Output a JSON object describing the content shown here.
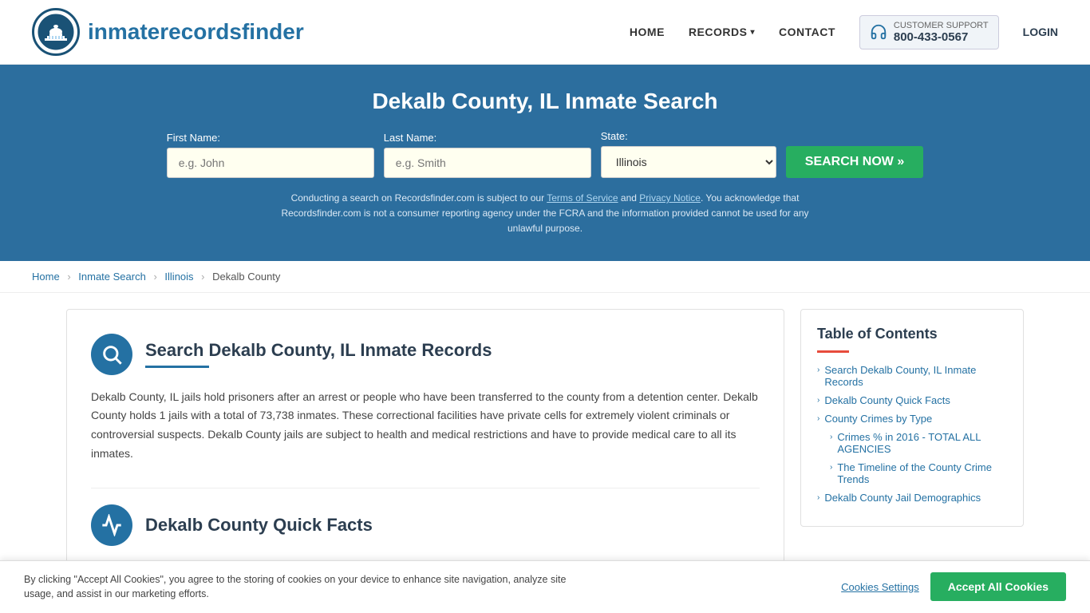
{
  "header": {
    "logo_text_main": "inmaterecords",
    "logo_text_accent": "finder",
    "nav": {
      "home": "HOME",
      "records": "RECORDS",
      "contact": "CONTACT",
      "login": "LOGIN"
    },
    "support": {
      "label": "CUSTOMER SUPPORT",
      "number": "800-433-0567"
    }
  },
  "hero": {
    "title": "Dekalb County, IL Inmate Search",
    "form": {
      "first_name_label": "First Name:",
      "first_name_placeholder": "e.g. John",
      "last_name_label": "Last Name:",
      "last_name_placeholder": "e.g. Smith",
      "state_label": "State:",
      "state_value": "Illinois",
      "search_button": "SEARCH NOW »"
    },
    "disclaimer": "Conducting a search on Recordsfinder.com is subject to our Terms of Service and Privacy Notice. You acknowledge that Recordsfinder.com is not a consumer reporting agency under the FCRA and the information provided cannot be used for any unlawful purpose."
  },
  "breadcrumb": {
    "home": "Home",
    "inmate_search": "Inmate Search",
    "state": "Illinois",
    "county": "Dekalb County"
  },
  "main": {
    "section1": {
      "title": "Search Dekalb County, IL Inmate Records",
      "body": "Dekalb County, IL jails hold prisoners after an arrest or people who have been transferred to the county from a detention center. Dekalb County holds 1 jails with a total of 73,738 inmates. These correctional facilities have private cells for extremely violent criminals or controversial suspects. Dekalb County jails are subject to health and medical restrictions and have to provide medical care to all its inmates."
    },
    "section2": {
      "title": "Dekalb County Quick Facts"
    }
  },
  "sidebar": {
    "toc_title": "Table of Contents",
    "items": [
      {
        "label": "Search Dekalb County, IL Inmate Records",
        "sub": false
      },
      {
        "label": "Dekalb County Quick Facts",
        "sub": false
      },
      {
        "label": "County Crimes by Type",
        "sub": false
      },
      {
        "label": "Crimes % in 2016 - TOTAL ALL AGENCIES",
        "sub": true
      },
      {
        "label": "The Timeline of the County Crime Trends",
        "sub": true
      },
      {
        "label": "Dekalb County Jail Demographics",
        "sub": false
      }
    ]
  },
  "cookie": {
    "text": "By clicking \"Accept All Cookies\", you agree to the storing of cookies on your device to enhance site navigation, analyze site usage, and assist in our marketing efforts.",
    "settings_label": "Cookies Settings",
    "accept_label": "Accept All Cookies"
  }
}
